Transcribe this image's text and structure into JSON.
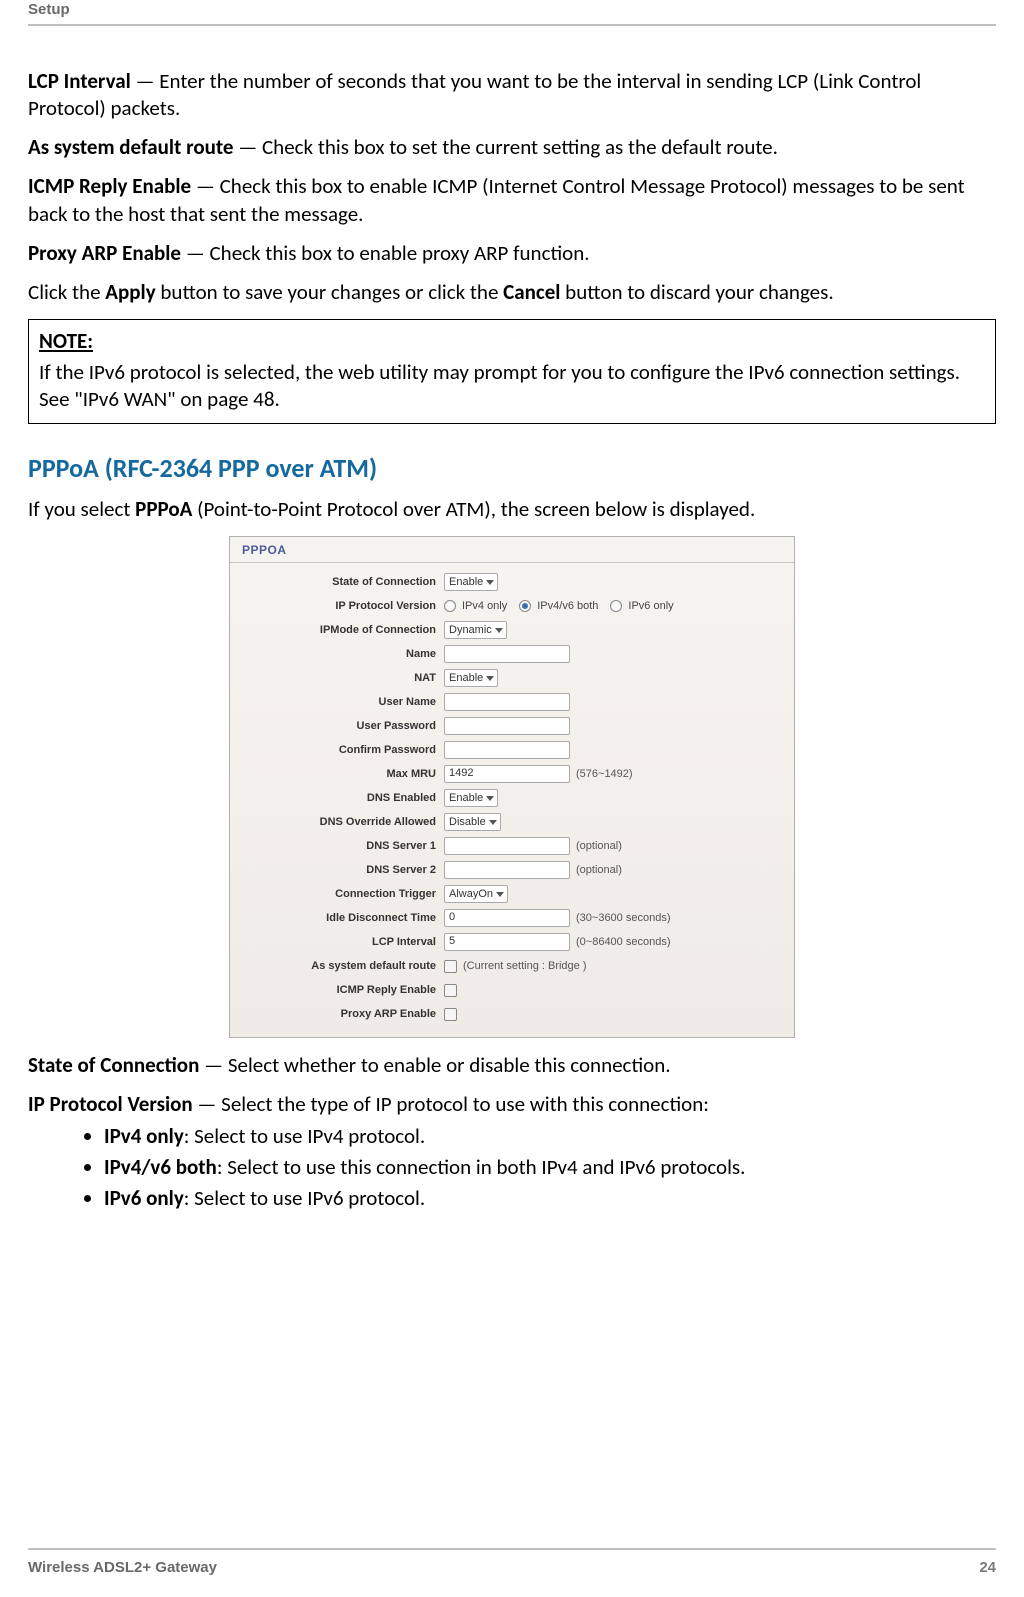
{
  "header": {
    "section": "Setup"
  },
  "footer": {
    "product": "Wireless ADSL2+ Gateway",
    "page": "24"
  },
  "paras": {
    "lcp_term": "LCP Interval",
    "lcp_text": " — Enter the number of seconds that you want to be the interval in sending LCP (Link Control Protocol) packets.",
    "route_term": "As system default route",
    "route_text": " — Check this box to set the current setting as the default route.",
    "icmp_term": "ICMP Reply Enable",
    "icmp_text": " — Check this box to enable ICMP (Internet Control Message Protocol) messages to be sent back to the host that sent the message.",
    "proxy_term": "Proxy ARP Enable",
    "proxy_text": " — Check this box to enable proxy ARP function.",
    "apply_pre": "Click the ",
    "apply_b": "Apply",
    "apply_mid": " button to save your changes or click the ",
    "cancel_b": "Cancel",
    "apply_post": " button to discard your changes."
  },
  "note": {
    "title": "NOTE:",
    "body": "If the IPv6 protocol is selected, the web utility may prompt for you to configure the IPv6 connection settings. See \"IPv6 WAN\" on page 48."
  },
  "section2": {
    "heading": "PPPoA (RFC-2364 PPP over ATM)",
    "intro_pre": "If you select ",
    "intro_b": "PPPoA",
    "intro_post": " (Point-to-Point Protocol over ATM), the screen below is displayed."
  },
  "after": {
    "state_term": "State of Connection",
    "state_text": " — Select whether to enable or disable this connection.",
    "ipver_term": "IP Protocol Version",
    "ipver_text": " — Select the type of IP protocol to use with this connection:",
    "li1_b": "IPv4 only",
    "li1_t": ": Select to use IPv4 protocol.",
    "li2_b": "IPv4/v6 both",
    "li2_t": ": Select to use this connection in both IPv4 and IPv6 protocols.",
    "li3_b": "IPv6 only",
    "li3_t": ": Select to use IPv6 protocol."
  },
  "shot": {
    "title": "PPPOA",
    "labels": {
      "state": "State of Connection",
      "ipver": "IP Protocol Version",
      "ipmode": "IPMode of Connection",
      "name": "Name",
      "nat": "NAT",
      "user": "User Name",
      "pass": "User Password",
      "confirm": "Confirm Password",
      "mru": "Max MRU",
      "dnse": "DNS Enabled",
      "dnso": "DNS Override Allowed",
      "dns1": "DNS Server 1",
      "dns2": "DNS Server 2",
      "trigger": "Connection Trigger",
      "idle": "Idle Disconnect Time",
      "lcp": "LCP Interval",
      "defroute": "As system default route",
      "icmp": "ICMP Reply Enable",
      "proxy": "Proxy ARP Enable"
    },
    "values": {
      "state": "Enable",
      "ipmode": "Dynamic",
      "nat": "Enable",
      "mru": "1492",
      "dnse": "Enable",
      "dnso": "Disable",
      "trigger": "AlwayOn",
      "idle": "0",
      "lcp": "5"
    },
    "radios": {
      "ipv4": "IPv4 only",
      "both": "IPv4/v6 both",
      "ipv6": "IPv6 only"
    },
    "hints": {
      "mru": "(576~1492)",
      "optional": "(optional)",
      "idle": "(30~3600 seconds)",
      "lcp": "(0~86400 seconds)",
      "defroute": "(Current setting : Bridge )"
    }
  }
}
